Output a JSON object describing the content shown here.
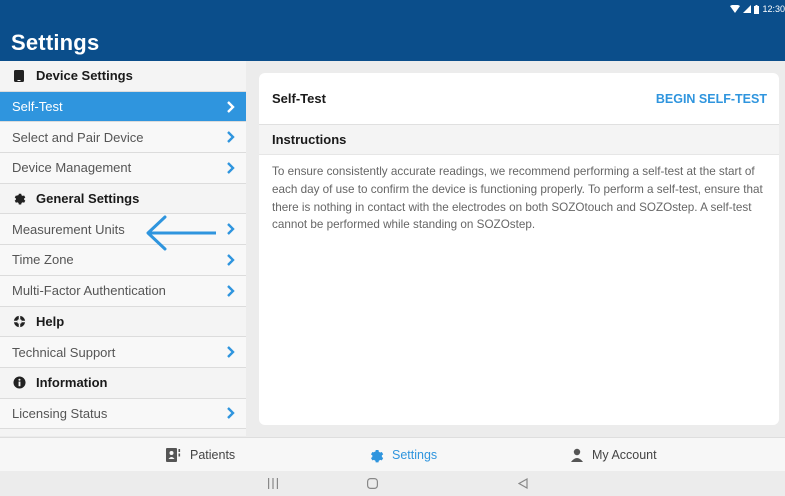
{
  "status_bar": {
    "time": "12:30",
    "icons": [
      "wifi-icon",
      "signal-icon",
      "battery-icon"
    ]
  },
  "header": {
    "title": "Settings"
  },
  "sidebar": {
    "sections": [
      {
        "label": "Device Settings",
        "icon": "tablet-icon",
        "items": [
          {
            "label": "Self-Test",
            "selected": true
          },
          {
            "label": "Select and Pair Device"
          },
          {
            "label": "Device Management"
          }
        ]
      },
      {
        "label": "General Settings",
        "icon": "gear-icon",
        "items": [
          {
            "label": "Measurement Units"
          },
          {
            "label": "Time Zone"
          },
          {
            "label": "Multi-Factor Authentication"
          }
        ]
      },
      {
        "label": "Help",
        "icon": "lifebuoy-icon",
        "items": [
          {
            "label": "Technical Support"
          }
        ]
      },
      {
        "label": "Information",
        "icon": "info-icon",
        "items": [
          {
            "label": "Licensing Status"
          }
        ]
      }
    ]
  },
  "panel": {
    "title": "Self-Test",
    "action_label": "BEGIN SELF-TEST",
    "instructions_heading": "Instructions",
    "instructions_text": "To ensure consistently accurate readings, we recommend performing a self-test at the start of each day of use to confirm the device is functioning properly. To perform a self-test, ensure that there is nothing in contact with the electrodes on both SOZOtouch and SOZOstep. A self-test cannot be performed while standing on SOZOstep."
  },
  "tabbar": {
    "tabs": [
      {
        "label": "Patients",
        "icon": "patients-icon",
        "active": false
      },
      {
        "label": "Settings",
        "icon": "gear-icon",
        "active": true
      },
      {
        "label": "My Account",
        "icon": "person-icon",
        "active": false
      }
    ]
  },
  "colors": {
    "header": "#0b4e8b",
    "accent": "#2f95de"
  }
}
